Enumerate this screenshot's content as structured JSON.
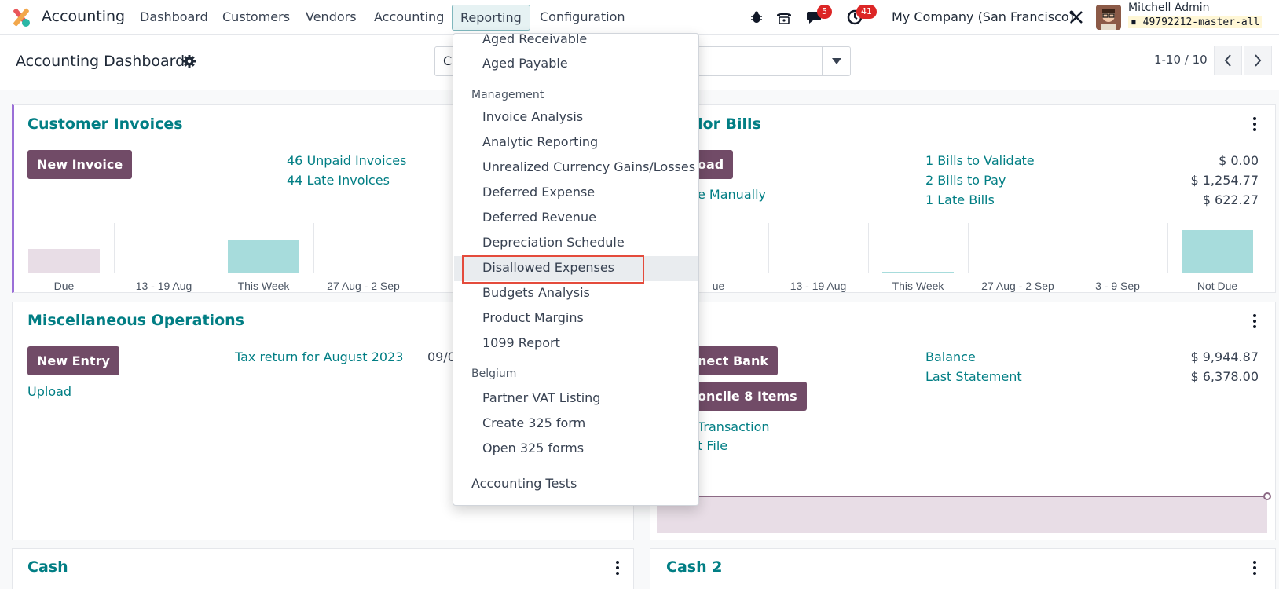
{
  "navbar": {
    "app_name": "Accounting",
    "menu": [
      "Dashboard",
      "Customers",
      "Vendors",
      "Accounting",
      "Reporting",
      "Configuration"
    ],
    "active_menu": "Reporting",
    "messages_count": "5",
    "activities_count": "41",
    "company": "My Company (San Francisco)",
    "user_name": "Mitchell Admin",
    "database": "49792212-master-all"
  },
  "control_panel": {
    "title": "Accounting Dashboard",
    "search_value": "C",
    "pager": "1-10 / 10"
  },
  "reporting_menu": {
    "top_items": [
      "Aged Receivable",
      "Aged Payable"
    ],
    "management_header": "Management",
    "management_items": [
      "Invoice Analysis",
      "Analytic Reporting",
      "Unrealized Currency Gains/Losses",
      "Deferred Expense",
      "Deferred Revenue",
      "Depreciation Schedule",
      "Disallowed Expenses",
      "Budgets Analysis",
      "Product Margins",
      "1099 Report"
    ],
    "highlighted_item": "Disallowed Expenses",
    "belgium_header": "Belgium",
    "belgium_items": [
      "Partner VAT Listing",
      "Create 325 form",
      "Open 325 forms"
    ],
    "footer_item": "Accounting Tests"
  },
  "customer_invoices": {
    "title": "Customer Invoices",
    "new_button": "New Invoice",
    "links": [
      "46 Unpaid Invoices",
      "44 Late Invoices"
    ]
  },
  "vendor_bills": {
    "title_visible": "lor Bills",
    "upload_button_visible": "oad",
    "create_manually_visible": "e Manually",
    "summary": [
      {
        "label": "1 Bills to Validate",
        "amount": "$ 0.00"
      },
      {
        "label": "2 Bills to Pay",
        "amount": "$ 1,254.77"
      },
      {
        "label": "1 Late Bills",
        "amount": "$ 622.27"
      }
    ]
  },
  "misc_operations": {
    "title": "Miscellaneous Operations",
    "new_button": "New Entry",
    "upload_link": "Upload",
    "tax_return": "Tax return for August 2023",
    "tax_date_visible": "09/0"
  },
  "bank": {
    "connect_button_visible": "nect Bank",
    "reconcile_button_visible": "oncile 8 Items",
    "transaction_link_visible": "Transaction",
    "file_link_visible": "t File",
    "balance_label": "Balance",
    "balance_amount": "$ 9,944.87",
    "statement_label": "Last Statement",
    "statement_amount": "$ 6,378.00"
  },
  "cash": {
    "title": "Cash"
  },
  "cash2": {
    "title": "Cash 2"
  },
  "chart_data": [
    {
      "type": "bar",
      "title": "",
      "categories": [
        "Due",
        "13 - 19 Aug",
        "This Week",
        "27 Aug - 2 Sep"
      ],
      "series": [
        {
          "values": [
            0.55,
            0,
            0.75,
            0
          ]
        }
      ],
      "colors": [
        "#e8dde6",
        "#e8dde6",
        "#a7dcdc",
        "#a7dcdc"
      ],
      "ylim": [
        0,
        1
      ]
    },
    {
      "type": "bar",
      "title": "",
      "categories": [
        "ue",
        "13 - 19 Aug",
        "This Week",
        "27 Aug - 2 Sep",
        "3 - 9 Sep",
        "Not Due"
      ],
      "series": [
        {
          "values": [
            0,
            0,
            0.02,
            0,
            0,
            0.98
          ]
        }
      ],
      "colors": [
        "#a7dcdc",
        "#a7dcdc",
        "#a7dcdc",
        "#a7dcdc",
        "#a7dcdc",
        "#a7dcdc"
      ],
      "ylim": [
        0,
        1
      ]
    }
  ],
  "colors": {
    "brand": "#714b67",
    "link": "#017e84",
    "badge": "#dc2626",
    "highlight_border": "#e44b3c"
  }
}
